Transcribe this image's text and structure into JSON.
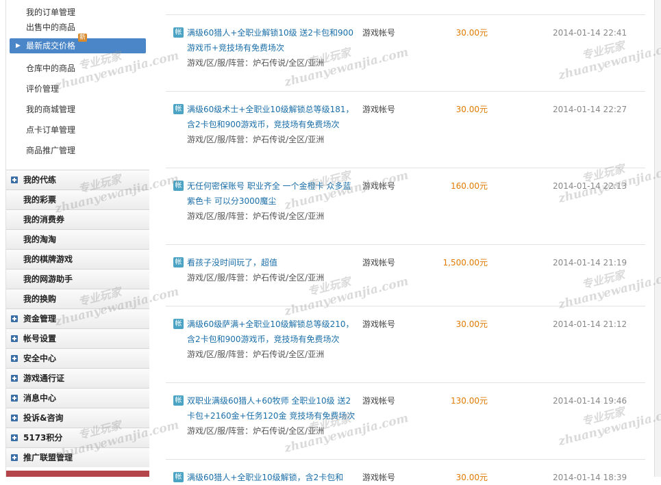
{
  "sidebar": {
    "sub_items": [
      "我的订单管理",
      "出售中的商品",
      "最新成交价格",
      "仓库中的商品",
      "评价管理",
      "我的商城管理",
      "点卡订单管理",
      "商品推广管理"
    ],
    "active_index": 2,
    "new_badge": "新",
    "sections": [
      {
        "label": "我的代练",
        "plus": true
      },
      {
        "label": "我的彩票",
        "plus": false
      },
      {
        "label": "我的消费券",
        "plus": false
      },
      {
        "label": "我的淘淘",
        "plus": false
      },
      {
        "label": "我的棋牌游戏",
        "plus": false
      },
      {
        "label": "我的网游助手",
        "plus": false
      },
      {
        "label": "我的换购",
        "plus": false
      },
      {
        "label": "资金管理",
        "plus": true
      },
      {
        "label": "帐号设置",
        "plus": true
      },
      {
        "label": "安全中心",
        "plus": true
      },
      {
        "label": "游戏通行证",
        "plus": true
      },
      {
        "label": "消息中心",
        "plus": true
      },
      {
        "label": "投诉&咨询",
        "plus": true
      },
      {
        "label": "5173积分",
        "plus": true
      },
      {
        "label": "推广联盟管理",
        "plus": true
      }
    ]
  },
  "listings": [
    {
      "tag": "帐",
      "title": "满级60猎人+全职业解锁10级 送2卡包和900游戏币+竞技场有免费场次",
      "server": "游戏/区/服/阵营：炉石传说/全区/亚洲",
      "type": "游戏帐号",
      "price": "30.00元",
      "time": "2014-01-14 22:41"
    },
    {
      "tag": "帐",
      "title": "满级60级术士+全职业10级解锁总等级181，含2卡包和900游戏币，竞技场有免费场次",
      "server": "游戏/区/服/阵营：炉石传说/全区/亚洲",
      "type": "游戏帐号",
      "price": "30.00元",
      "time": "2014-01-14 22:27"
    },
    {
      "tag": "帐",
      "title": "无任何密保账号 职业齐全 一个金橙卡 众多蓝紫色卡 可以分3000魔尘",
      "server": "游戏/区/服/阵营：炉石传说/全区/亚洲",
      "type": "游戏帐号",
      "price": "160.00元",
      "time": "2014-01-14 22:13"
    },
    {
      "tag": "帐",
      "title": "看孩子没时间玩了，超值",
      "server": "游戏/区/服/阵营：炉石传说/全区/亚洲",
      "type": "游戏帐号",
      "price": "1,500.00元",
      "time": "2014-01-14 21:19"
    },
    {
      "tag": "帐",
      "title": "满级60级萨满+全职业10级解锁总等级210，含2卡包和900游戏币，竞技场有免费场次",
      "server": "游戏/区/服/阵营：炉石传说/全区/亚洲",
      "type": "游戏帐号",
      "price": "30.00元",
      "time": "2014-01-14 21:12"
    },
    {
      "tag": "帐",
      "title": "双职业满级60猎人+60牧师 全职业10级 送2卡包+2160金+任务120金 竞技场有免费场次",
      "server": "游戏/区/服/阵营：炉石传说/全区/亚洲",
      "type": "游戏帐号",
      "price": "130.00元",
      "time": "2014-01-14 19:46"
    },
    {
      "tag": "帐",
      "title": "满级60猎人+全职业10级解锁，含2卡包和",
      "server": "",
      "type": "游戏帐号",
      "price": "30.00元",
      "time": "2014-01-14 18:39"
    }
  ],
  "watermark": {
    "cn": "专业玩家",
    "en": "zhuanyewanjia.com"
  }
}
